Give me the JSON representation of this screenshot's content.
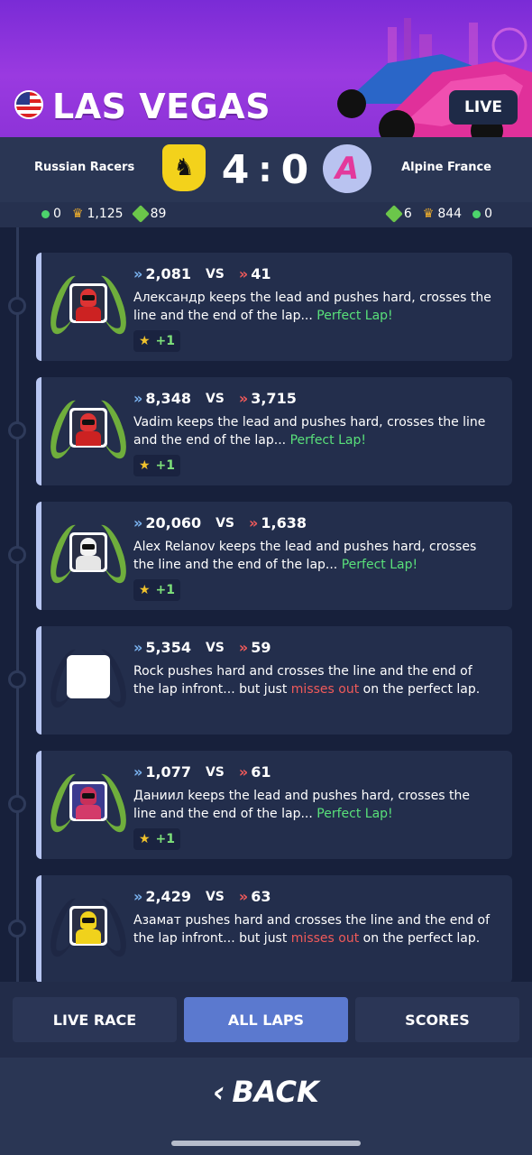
{
  "header": {
    "title": "LAS VEGAS",
    "live_label": "LIVE",
    "flag_icon": "us-flag-icon"
  },
  "match": {
    "home_team": "Russian Racers",
    "away_team": "Alpine France",
    "home_score": "4",
    "separator": ":",
    "away_score": "0",
    "home_stats": {
      "green": "0",
      "crowns": "1,125",
      "gems": "89"
    },
    "away_stats": {
      "gems": "6",
      "crowns": "844",
      "green": "0"
    }
  },
  "laps": [
    {
      "left": "2,081",
      "vs": "VS",
      "right": "41",
      "text": "Александр keeps the lead and pushes hard, crosses the line and the end of the lap... ",
      "highlight": "Perfect Lap!",
      "tail": "",
      "result": "perfect",
      "reward": "+1",
      "helmet": "red"
    },
    {
      "left": "8,348",
      "vs": "VS",
      "right": "3,715",
      "text": "Vadim keeps the lead and pushes hard, crosses the line and the end of the lap... ",
      "highlight": "Perfect Lap!",
      "tail": "",
      "result": "perfect",
      "reward": "+1",
      "helmet": "red"
    },
    {
      "left": "20,060",
      "vs": "VS",
      "right": "1,638",
      "text": "Alex Relanov keeps the lead and pushes hard, crosses the line and the end of the lap... ",
      "highlight": "Perfect Lap!",
      "tail": "",
      "result": "perfect",
      "reward": "+1",
      "helmet": "white"
    },
    {
      "left": "5,354",
      "vs": "VS",
      "right": "59",
      "text": "Rock pushes hard and crosses the line and the end of the lap infront... but just ",
      "highlight": "misses out",
      "tail": " on the perfect lap.",
      "result": "miss",
      "reward": "",
      "helmet": "empty"
    },
    {
      "left": "1,077",
      "vs": "VS",
      "right": "61",
      "text": "Даниил keeps the lead and pushes hard, crosses the line and the end of the lap... ",
      "highlight": "Perfect Lap!",
      "tail": "",
      "result": "perfect",
      "reward": "+1",
      "helmet": "purple"
    },
    {
      "left": "2,429",
      "vs": "VS",
      "right": "63",
      "text": "Азамат pushes hard and crosses the line and the end of the lap infront... but just ",
      "highlight": "misses out",
      "tail": " on the perfect lap.",
      "result": "miss",
      "reward": "",
      "helmet": "yellow"
    }
  ],
  "tabs": {
    "live_race": "LIVE RACE",
    "all_laps": "ALL LAPS",
    "scores": "SCORES",
    "active": "all_laps"
  },
  "back_label": "BACK",
  "colors": {
    "accent": "#5b79cf",
    "perfect": "#59e07a",
    "miss": "#f05a5a",
    "header": "#9a3ae0"
  }
}
